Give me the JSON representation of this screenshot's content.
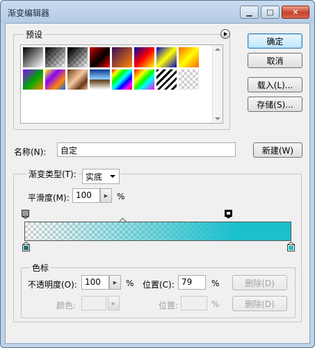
{
  "window": {
    "title": "渐变编辑器",
    "minimize_label": "▁",
    "maximize_label": "□",
    "close_label": "✕"
  },
  "presets": {
    "label": "预设",
    "menu_icon": "circle-arrow-right-icon",
    "swatches": [
      {
        "name": "black-white",
        "css": "linear-gradient(135deg,#000,#fff)"
      },
      {
        "name": "black-transparent",
        "css": "linear-gradient(135deg,#000,rgba(0,0,0,0))"
      },
      {
        "name": "foreground-transparent",
        "css": "linear-gradient(135deg,#000 10%,rgba(0,0,0,0))"
      },
      {
        "name": "red-black",
        "css": "linear-gradient(135deg,#c00,#000 55%,#e00)"
      },
      {
        "name": "violet-orange",
        "css": "linear-gradient(135deg,#3a0a5a,#f80)"
      },
      {
        "name": "blue-red-yellow",
        "css": "linear-gradient(135deg,#00a,#f00 50%,#ff0)"
      },
      {
        "name": "blue-yellow-blue",
        "css": "linear-gradient(135deg,#00c,#ff0 50%,#00c)"
      },
      {
        "name": "orange-yellow-orange",
        "css": "linear-gradient(135deg,#f60,#ff0 50%,#f60)"
      },
      {
        "name": "violet-green-orange",
        "css": "linear-gradient(135deg,#80f,#0a0 55%,#f80)"
      },
      {
        "name": "yellow-violet-orange-blue",
        "css": "linear-gradient(135deg,#ff0,#80f 35%,#f80 70%,#06f)"
      },
      {
        "name": "copper",
        "css": "linear-gradient(135deg,#6b3a1a,#f5c9a0 45%,#6b3a1a 75%,#e8b48a)"
      },
      {
        "name": "chrome",
        "css": "linear-gradient(180deg,#0a3a8a,#8fd0ff 48%,#5a3a10 52%,#fff)"
      },
      {
        "name": "spectrum",
        "css": "linear-gradient(135deg,#f00,#ff0,#0f0,#0ff,#00f,#f0f,#f00)"
      },
      {
        "name": "transparent-rainbow",
        "css": "linear-gradient(135deg,#f00,#ff0 30%,#0f0 50%,#0ff 65%,#f0f)"
      },
      {
        "name": "transparent-stripes",
        "css": "repeating-linear-gradient(135deg,#000 0 3px,#fff 3px 7px)"
      },
      {
        "name": "checker-empty",
        "css": "checker"
      }
    ]
  },
  "buttons": {
    "ok": "确定",
    "cancel": "取消",
    "load": "载入(L)...",
    "save": "存储(S)...",
    "new": "新建(W)",
    "delete_opacity": "删除(D)",
    "delete_color": "删除(D)"
  },
  "name": {
    "label": "名称(N):",
    "value": "自定"
  },
  "gradient": {
    "type_label": "渐变类型(T):",
    "type_value": "实底",
    "smoothness_label": "平滑度(M):",
    "smoothness_value": "100",
    "smoothness_unit": "%",
    "colors": {
      "start": "#9fa6ad",
      "end": "#1cbfcc"
    },
    "end_opacity_fraction": 1.0,
    "start_opacity_fraction": 0.0
  },
  "stops": {
    "group_label": "色标",
    "opacity_label": "不透明度(O):",
    "opacity_value": "100",
    "opacity_unit": "%",
    "opacity_location_label": "位置(C):",
    "opacity_location_value": "79",
    "opacity_location_unit": "%",
    "color_label": "颜色:",
    "color_location_label": "位置:",
    "color_location_unit": "%"
  }
}
